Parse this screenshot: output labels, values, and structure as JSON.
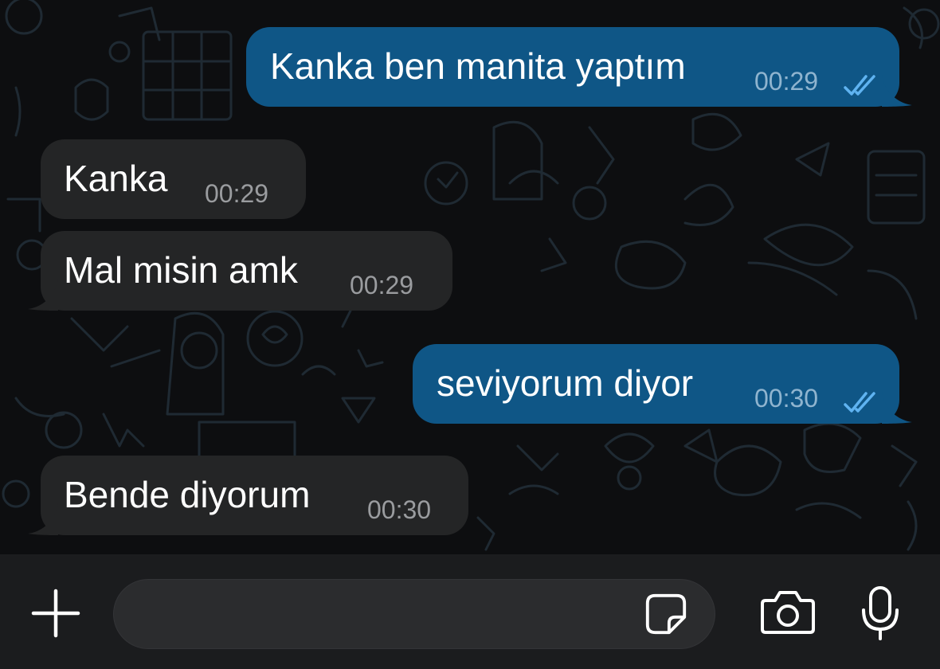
{
  "colors": {
    "incoming_bubble": "#242526",
    "outgoing_bubble": "#0f5686",
    "read_ticks": "#5fb3f1",
    "background": "#0d0e10",
    "input_bar": "#1b1c1e"
  },
  "messages": [
    {
      "direction": "outgoing",
      "text": "Kanka ben manita yaptım",
      "time": "00:29",
      "status": "read"
    },
    {
      "direction": "incoming",
      "text": "Kanka",
      "time": "00:29"
    },
    {
      "direction": "incoming",
      "text": "Mal misin amk",
      "time": "00:29"
    },
    {
      "direction": "outgoing",
      "text": "seviyorum diyor",
      "time": "00:30",
      "status": "read"
    },
    {
      "direction": "incoming",
      "text": "Bende diyorum",
      "time": "00:30"
    }
  ],
  "composer": {
    "placeholder": "",
    "value": "",
    "icons": [
      "plus-icon",
      "sticker-icon",
      "camera-icon",
      "microphone-icon"
    ]
  }
}
